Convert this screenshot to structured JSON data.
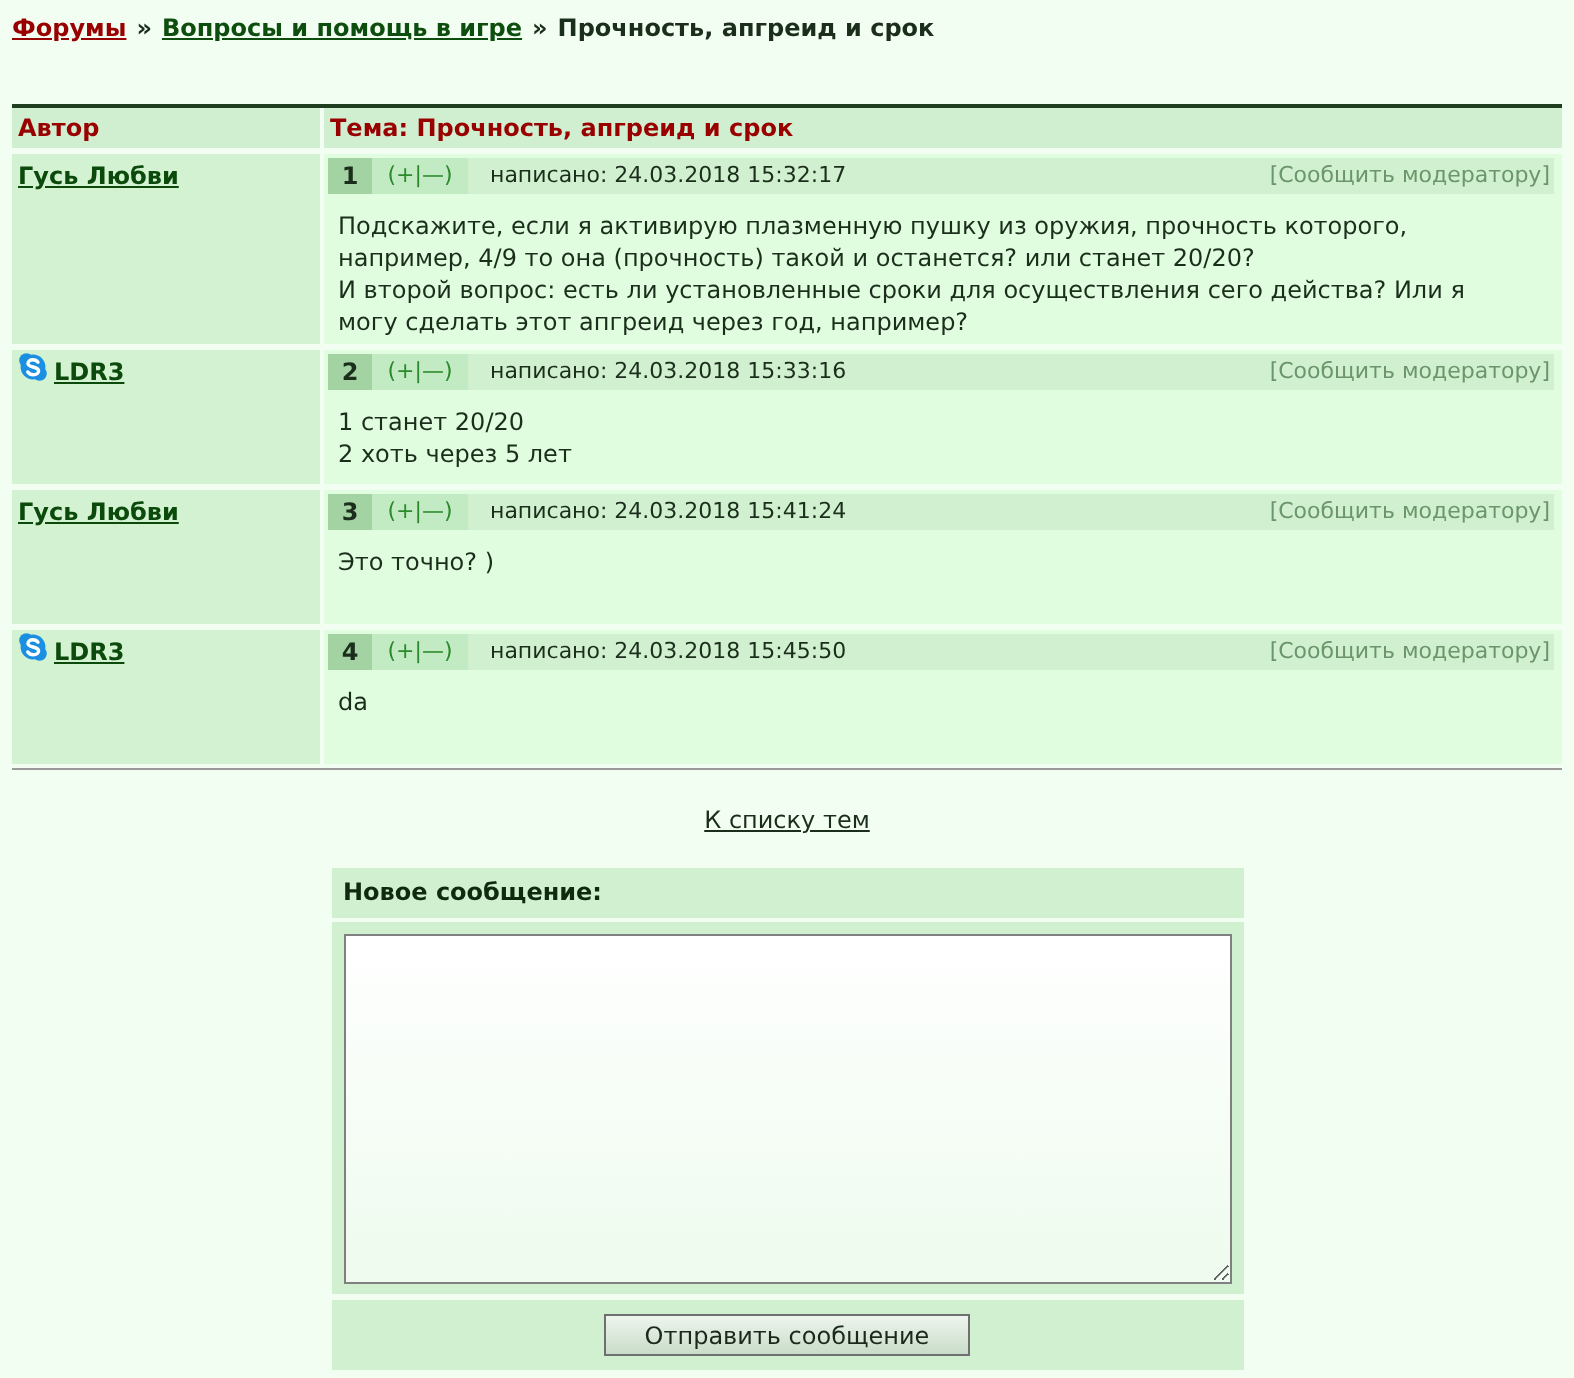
{
  "breadcrumb": [
    {
      "kind": "root",
      "text": "Форумы"
    },
    {
      "kind": "separator",
      "text": "»"
    },
    {
      "kind": "section",
      "text": "Вопросы и помощь в игре"
    },
    {
      "kind": "separator",
      "text": "»"
    },
    {
      "kind": "current",
      "text": "Прочность, апгреид и срок"
    }
  ],
  "table": {
    "columns": [
      "Автор",
      "Тема: Прочность, апгреид и срок"
    ],
    "posts": [
      {
        "author": "Гусь Любви",
        "contact_icon": false,
        "number": "1",
        "votes": "(+|—)",
        "posted": "написано: 24.03.2018 15:32:17",
        "report": "[Сообщить модератору]",
        "body": [
          "Подскажите, если я активирую плазменную пушку из оружия, прочность которого,",
          "например, 4/9 то она (прочность) такой и останется? или станет 20/20?",
          "И второй вопрос: есть ли установленные сроки для осуществления сего действа? Или я",
          "могу сделать этот апгреид через год, например?"
        ]
      },
      {
        "author": "LDR3",
        "contact_icon": true,
        "number": "2",
        "votes": "(+|—)",
        "posted": "написано: 24.03.2018 15:33:16",
        "report": "[Сообщить модератору]",
        "body": [
          "1 станет 20/20",
          "2 хоть через 5 лет"
        ]
      },
      {
        "author": "Гусь Любви",
        "contact_icon": false,
        "number": "3",
        "votes": "(+|—)",
        "posted": "написано: 24.03.2018 15:41:24",
        "report": "[Сообщить модератору]",
        "body": [
          "Это точно? )"
        ]
      },
      {
        "author": "LDR3",
        "contact_icon": true,
        "number": "4",
        "votes": "(+|—)",
        "posted": "написано: 24.03.2018 15:45:50",
        "report": "[Сообщить модератору]",
        "body": [
          "da"
        ]
      }
    ]
  },
  "back_link": "К списку тем",
  "reply_form": {
    "title": "Новое сообщение:",
    "submit": "Отправить сообщение"
  }
}
